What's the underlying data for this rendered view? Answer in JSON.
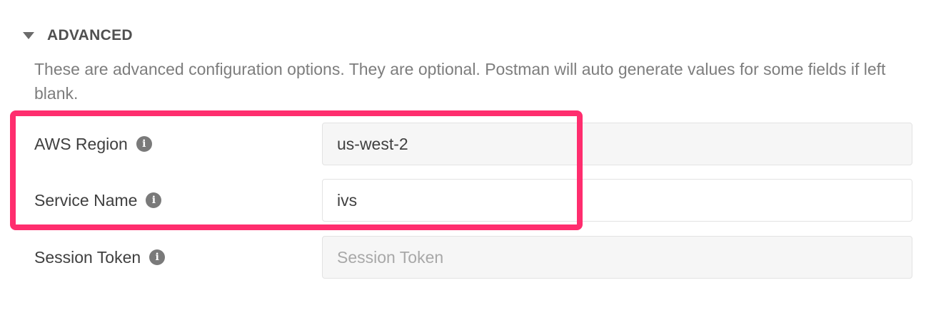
{
  "advanced": {
    "title": "ADVANCED",
    "description": "These are advanced configuration options. They are optional. Postman will auto generate values for some fields if left blank."
  },
  "fields": [
    {
      "label": "AWS Region",
      "value": "us-west-2",
      "placeholder": ""
    },
    {
      "label": "Service Name",
      "value": "ivs",
      "placeholder": ""
    },
    {
      "label": "Session Token",
      "value": "",
      "placeholder": "Session Token"
    }
  ],
  "icons": {
    "info": "i"
  },
  "colors": {
    "highlight": "#ff2d6e",
    "info_icon": "#7a7a7a",
    "input_bg": "#f6f6f6"
  }
}
